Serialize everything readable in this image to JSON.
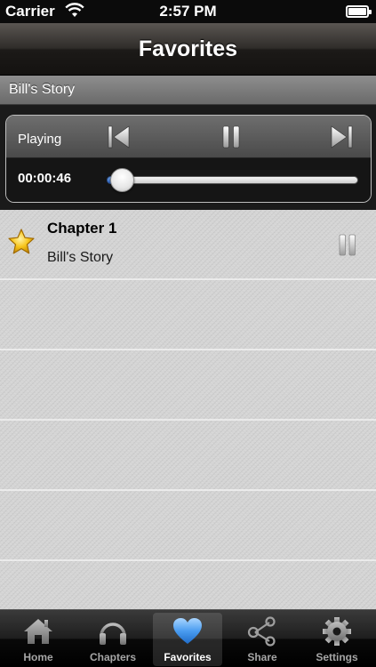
{
  "status_bar": {
    "carrier": "Carrier",
    "time": "2:57 PM",
    "wifi_icon": "wifi-icon",
    "battery_icon": "battery-icon",
    "battery_level": 1.0
  },
  "nav": {
    "title": "Favorites"
  },
  "story_header": {
    "title": "Bill's Story"
  },
  "player": {
    "status_label": "Playing",
    "elapsed": "00:00:46",
    "progress": 0.06,
    "controls": [
      "previous-track-icon",
      "pause-icon",
      "next-track-icon"
    ]
  },
  "favorites": [
    {
      "title": "Chapter 1",
      "subtitle": "Bill's Story",
      "favorite_icon": "star-icon",
      "state_icon": "pause-icon"
    }
  ],
  "tabs": [
    {
      "label": "Home",
      "icon": "home-icon",
      "active": false
    },
    {
      "label": "Chapters",
      "icon": "headphones-icon",
      "active": false
    },
    {
      "label": "Favorites",
      "icon": "heart-icon",
      "active": true
    },
    {
      "label": "Share",
      "icon": "share-icon",
      "active": false
    },
    {
      "label": "Settings",
      "icon": "gear-icon",
      "active": false
    }
  ],
  "colors": {
    "accent_blue": "#3f8fe0",
    "slider_fill": "#2e66c6",
    "star": "#f7c51c"
  }
}
